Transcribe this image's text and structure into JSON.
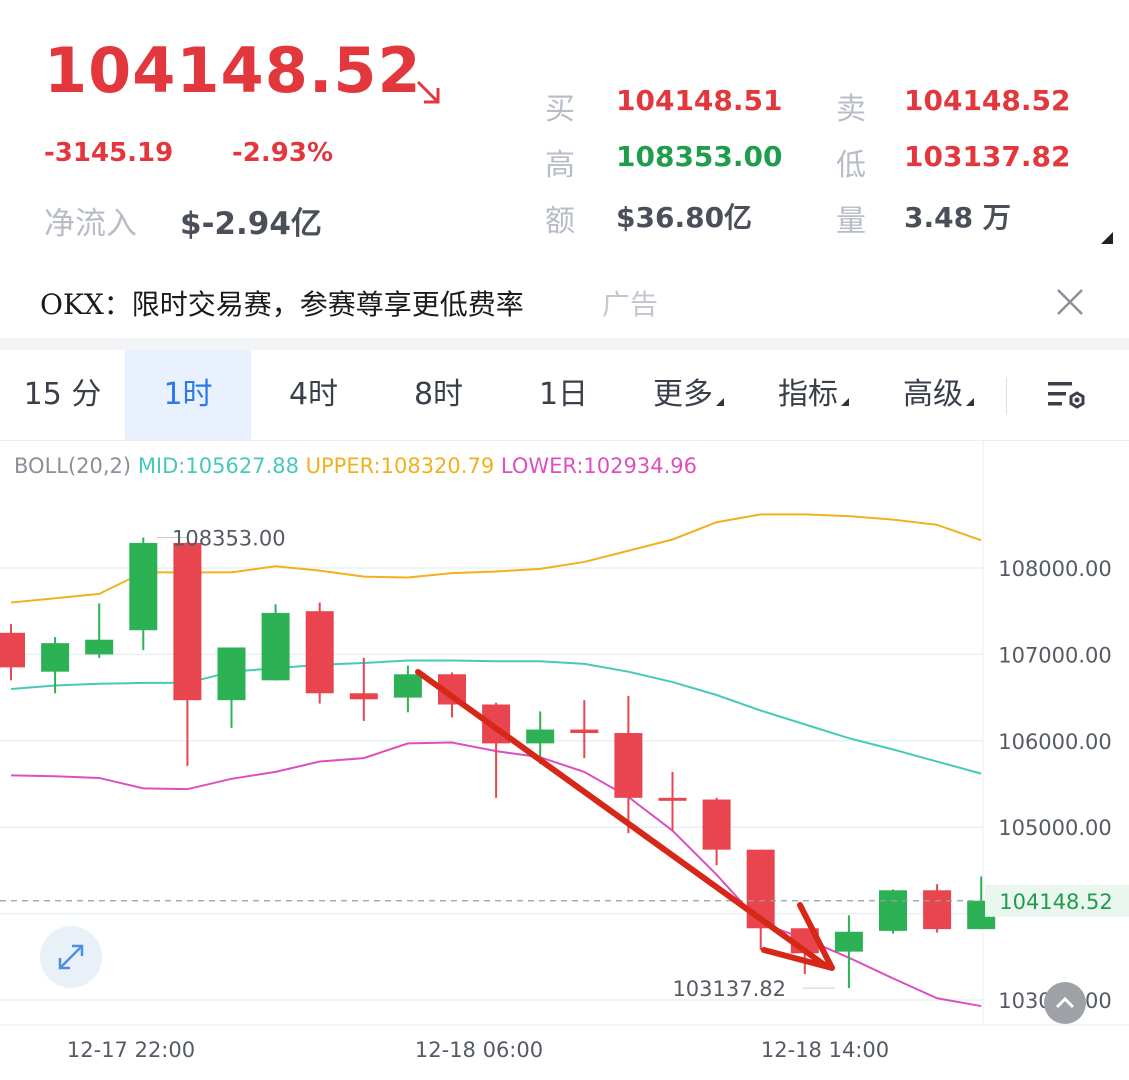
{
  "ticker": {
    "price": "104148.52",
    "change": "-3145.19",
    "change_pct": "-2.93%",
    "net_inflow_label": "净流入",
    "net_inflow_value": "$-2.94亿",
    "direction_icon": "arrow-down-right-icon"
  },
  "quote": {
    "buy_label": "买",
    "buy_value": "104148.51",
    "sell_label": "卖",
    "sell_value": "104148.52",
    "high_label": "高",
    "high_value": "108353.00",
    "low_label": "低",
    "low_value": "103137.82",
    "amount_label": "额",
    "amount_value": "$36.80亿",
    "volume_label": "量",
    "volume_value": "3.48 万"
  },
  "ad": {
    "text": "OKX：限时交易赛，参赛尊享更低费率",
    "tag": "广告"
  },
  "tabs": [
    {
      "label": "15 分",
      "active": false
    },
    {
      "label": "1时",
      "active": true
    },
    {
      "label": "4时",
      "active": false
    },
    {
      "label": "8时",
      "active": false
    },
    {
      "label": "1日",
      "active": false
    },
    {
      "label": "更多",
      "active": false,
      "dropdown": true
    },
    {
      "label": "指标",
      "active": false,
      "dropdown": true
    },
    {
      "label": "高级",
      "active": false,
      "dropdown": true
    }
  ],
  "indicator": {
    "name": "BOLL(20,2)",
    "mid": "MID:105627.88",
    "upper": "UPPER:108320.79",
    "lower": "LOWER:102934.96"
  },
  "colors": {
    "up": "#2db155",
    "down": "#e8454f",
    "mid": "#46c9bb",
    "upper": "#f2b01e",
    "lower": "#dd4fc1",
    "annotation_arrow": "#d62718",
    "accent": "#2a7be4"
  },
  "chart_data": {
    "type": "candlestick",
    "y_ticks": [
      "108000.00",
      "107000.00",
      "106000.00",
      "105000.00",
      "103000.00"
    ],
    "ylim": [
      102700,
      109100
    ],
    "x_labels": [
      "12-17 22:00",
      "12-18 06:00",
      "12-18 14:00"
    ],
    "current_price_label": "104148.52",
    "high_marker": "108353.00",
    "low_marker": "103137.82",
    "candles": [
      {
        "o": 107250,
        "h": 107350,
        "c": 106850,
        "l": 106700
      },
      {
        "o": 106800,
        "h": 107200,
        "c": 107130,
        "l": 106550
      },
      {
        "o": 107000,
        "h": 107590,
        "c": 107170,
        "l": 106960
      },
      {
        "o": 107280,
        "h": 108353,
        "c": 108290,
        "l": 107050
      },
      {
        "o": 108290,
        "h": 108300,
        "c": 106470,
        "l": 105710
      },
      {
        "o": 106470,
        "h": 107080,
        "c": 107080,
        "l": 106150
      },
      {
        "o": 106700,
        "h": 107580,
        "c": 107480,
        "l": 106700
      },
      {
        "o": 107500,
        "h": 107600,
        "c": 106550,
        "l": 106430
      },
      {
        "o": 106550,
        "h": 106960,
        "c": 106480,
        "l": 106230
      },
      {
        "o": 106500,
        "h": 106870,
        "c": 106770,
        "l": 106330
      },
      {
        "o": 106770,
        "h": 106790,
        "c": 106420,
        "l": 106270
      },
      {
        "o": 106420,
        "h": 106440,
        "c": 105970,
        "l": 105340
      },
      {
        "o": 105970,
        "h": 106340,
        "c": 106130,
        "l": 105730
      },
      {
        "o": 106130,
        "h": 106470,
        "c": 106090,
        "l": 105800
      },
      {
        "o": 106090,
        "h": 106520,
        "c": 105340,
        "l": 104930
      },
      {
        "o": 105340,
        "h": 105640,
        "c": 105320,
        "l": 104960
      },
      {
        "o": 105320,
        "h": 105340,
        "c": 104740,
        "l": 104560
      },
      {
        "o": 104740,
        "h": 104740,
        "c": 103830,
        "l": 103580
      },
      {
        "o": 103830,
        "h": 103830,
        "c": 103540,
        "l": 103300
      },
      {
        "o": 103560,
        "h": 103980,
        "c": 103790,
        "l": 103137.82
      },
      {
        "o": 103800,
        "h": 104280,
        "c": 104270,
        "l": 103770
      },
      {
        "o": 104270,
        "h": 104340,
        "c": 103820,
        "l": 103780
      },
      {
        "o": 103820,
        "h": 104430,
        "c": 104148.52,
        "l": 103820
      }
    ],
    "boll_upper": [
      107600,
      107650,
      107700,
      107950,
      107950,
      107950,
      108020,
      107970,
      107900,
      107890,
      107940,
      107960,
      107990,
      108070,
      108200,
      108330,
      108530,
      108620,
      108620,
      108600,
      108560,
      108500,
      108320
    ],
    "boll_mid": [
      106600,
      106640,
      106660,
      106670,
      106670,
      106800,
      106840,
      106880,
      106900,
      106930,
      106930,
      106920,
      106920,
      106890,
      106800,
      106680,
      106530,
      106350,
      106190,
      106030,
      105900,
      105760,
      105620
    ],
    "boll_lower": [
      105600,
      105590,
      105570,
      105450,
      105440,
      105560,
      105640,
      105760,
      105800,
      105970,
      105980,
      105880,
      105810,
      105640,
      105350,
      104960,
      104450,
      103890,
      103710,
      103490,
      103250,
      103020,
      102930
    ]
  }
}
